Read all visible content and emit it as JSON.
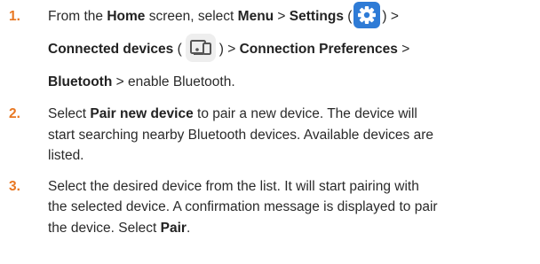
{
  "steps": [
    {
      "number": "1.",
      "lines": [
        [
          {
            "t": "From the ",
            "b": false
          },
          {
            "t": "Home",
            "b": true
          },
          {
            "t": " screen, select ",
            "b": false
          },
          {
            "t": "Menu",
            "b": true
          },
          {
            "t": " > ",
            "b": false
          },
          {
            "t": "Settings",
            "b": true
          },
          {
            "t": " (",
            "b": false
          },
          {
            "icon": "settings-gear-icon"
          },
          {
            "t": ") >",
            "b": false
          }
        ],
        [
          {
            "t": "Connected devices",
            "b": true
          },
          {
            "t": " (",
            "b": false
          },
          {
            "icon": "connected-devices-icon"
          },
          {
            "t": ") > ",
            "b": false
          },
          {
            "t": "Connection Preferences",
            "b": true
          },
          {
            "t": " >",
            "b": false
          }
        ],
        [
          {
            "t": "Bluetooth",
            "b": true
          },
          {
            "t": " > enable Bluetooth.",
            "b": false
          }
        ]
      ]
    },
    {
      "number": "2.",
      "lines": [
        [
          {
            "t": "Select ",
            "b": false
          },
          {
            "t": "Pair new device",
            "b": true
          },
          {
            "t": " to pair a new device. The device will",
            "b": false
          }
        ],
        [
          {
            "t": "start searching nearby Bluetooth devices. Available devices are",
            "b": false
          }
        ],
        [
          {
            "t": "listed.",
            "b": false
          }
        ]
      ]
    },
    {
      "number": "3.",
      "lines": [
        [
          {
            "t": "Select the desired device from the list. It will start pairing with",
            "b": false
          }
        ],
        [
          {
            "t": "the selected device. A confirmation message is displayed to pair",
            "b": false
          }
        ],
        [
          {
            "t": "the device. Select ",
            "b": false
          },
          {
            "t": "Pair",
            "b": true
          },
          {
            "t": ".",
            "b": false
          }
        ]
      ]
    }
  ],
  "colors": {
    "number": "#e87722",
    "gear_bg": "#2e7bd6",
    "devices_bg": "#eeeeee"
  }
}
